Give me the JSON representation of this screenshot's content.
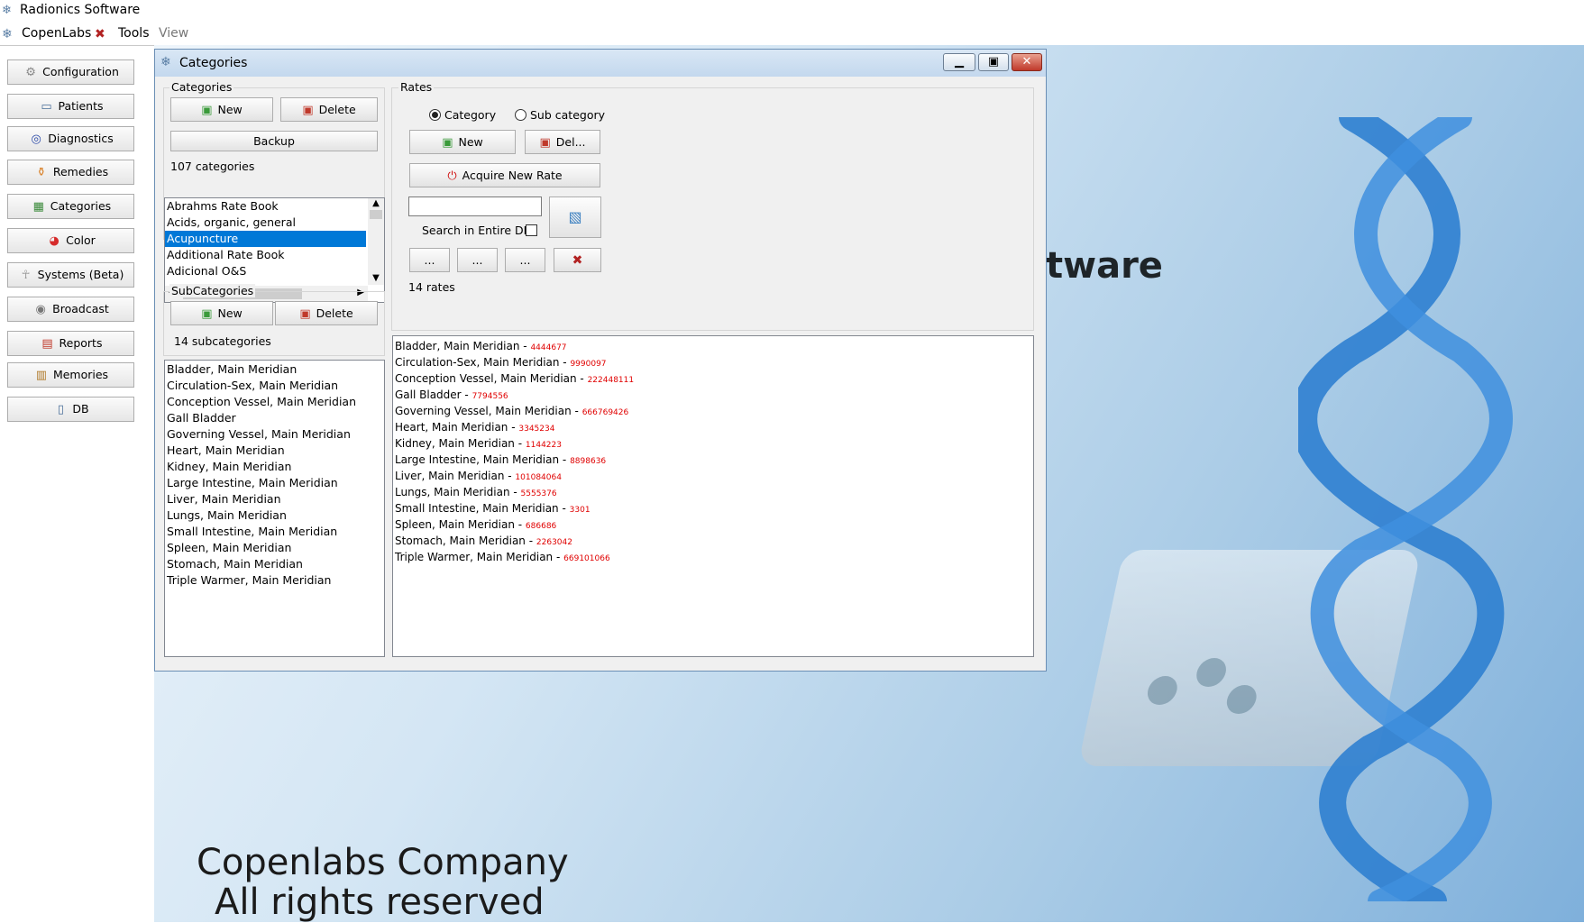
{
  "app": {
    "title": "Radionics Software"
  },
  "menu": {
    "copenlabs": "CopenLabs",
    "tools": "Tools",
    "view": "View"
  },
  "sidebar": {
    "items": [
      {
        "label": "Configuration",
        "icon": "gear-icon"
      },
      {
        "label": "Patients",
        "icon": "id-card-icon"
      },
      {
        "label": "Diagnostics",
        "icon": "target-icon"
      },
      {
        "label": "Remedies",
        "icon": "bottles-icon"
      },
      {
        "label": "Categories",
        "icon": "categories-icon"
      },
      {
        "label": "Color",
        "icon": "color-wheel-icon"
      },
      {
        "label": "Systems (Beta)",
        "icon": "body-icon"
      },
      {
        "label": "Broadcast",
        "icon": "broadcast-icon"
      },
      {
        "label": "Reports",
        "icon": "report-icon"
      },
      {
        "label": "Memories",
        "icon": "clipboard-icon"
      },
      {
        "label": "DB",
        "icon": "database-icon"
      }
    ]
  },
  "background": {
    "partial_title": "tware",
    "copyright_line1": "Copenlabs Company",
    "copyright_line2": "All rights reserved"
  },
  "window": {
    "title": "Categories",
    "categories": {
      "group_label": "Categories",
      "new_label": "New",
      "delete_label": "Delete",
      "backup_label": "Backup",
      "count_text": "107 categories",
      "items": [
        "Abrahms Rate Book",
        "Acids, organic, general",
        "Acupuncture",
        "Additional Rate Book",
        "Adicional O&S"
      ],
      "selected": "Acupuncture"
    },
    "subcategories": {
      "group_label": "SubCategories",
      "new_label": "New",
      "delete_label": "Delete",
      "count_text": "14 subcategories",
      "items": [
        "Bladder, Main Meridian",
        "Circulation-Sex, Main Meridian",
        "Conception Vessel, Main Meridian",
        "Gall Bladder",
        "Governing Vessel, Main Meridian",
        "Heart, Main Meridian",
        "Kidney, Main Meridian",
        "Large Intestine, Main Meridian",
        "Liver, Main Meridian",
        "Lungs, Main Meridian",
        "Small Intestine, Main Meridian",
        "Spleen, Main Meridian",
        "Stomach, Main Meridian",
        "Triple Warmer, Main Meridian"
      ]
    },
    "rates": {
      "group_label": "Rates",
      "radio_category": "Category",
      "radio_subcategory": "Sub category",
      "selected_radio": "Category",
      "new_label": "New",
      "del_label": "Del...",
      "acquire_label": "Acquire New Rate",
      "search_value": "",
      "search_entire_db": "Search in Entire DB",
      "ellipsis": "...",
      "count_text": "14 rates",
      "items": [
        {
          "name": "Bladder, Main Meridian",
          "rate": "4444677"
        },
        {
          "name": "Circulation-Sex, Main Meridian",
          "rate": "9990097"
        },
        {
          "name": "Conception Vessel, Main Meridian",
          "rate": "222448111"
        },
        {
          "name": "Gall Bladder",
          "rate": "7794556"
        },
        {
          "name": "Governing Vessel, Main Meridian",
          "rate": "666769426"
        },
        {
          "name": "Heart, Main Meridian",
          "rate": "3345234"
        },
        {
          "name": "Kidney, Main Meridian",
          "rate": "1144223"
        },
        {
          "name": "Large Intestine, Main Meridian",
          "rate": "8898636"
        },
        {
          "name": "Liver, Main Meridian",
          "rate": "101084064"
        },
        {
          "name": "Lungs, Main Meridian",
          "rate": "5555376"
        },
        {
          "name": "Small Intestine, Main Meridian",
          "rate": "3301"
        },
        {
          "name": "Spleen, Main Meridian",
          "rate": "686686"
        },
        {
          "name": "Stomach, Main Meridian",
          "rate": "2263042"
        },
        {
          "name": "Triple Warmer, Main Meridian",
          "rate": "669101066"
        }
      ]
    }
  },
  "colors": {
    "accent": "#0078d7",
    "rate_number": "#e00000",
    "dna": "#2f7fd0"
  }
}
